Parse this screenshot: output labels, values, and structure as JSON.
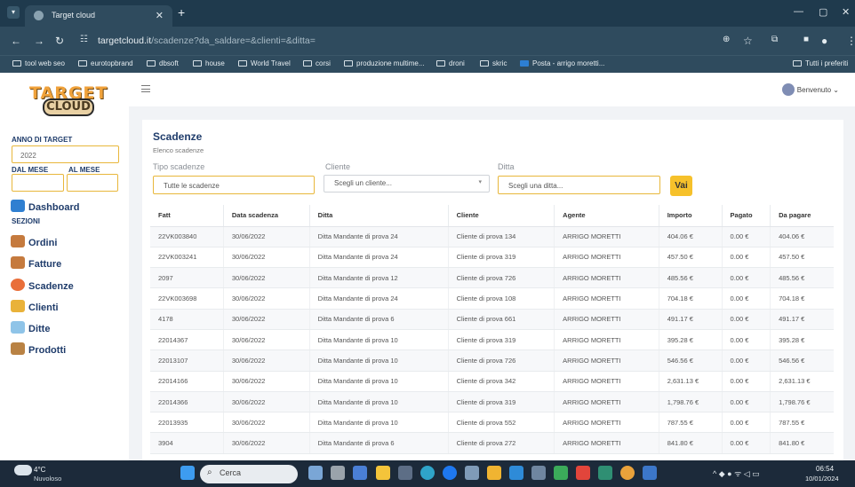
{
  "browser": {
    "tab_title": "Target cloud",
    "url_host": "targetcloud.it",
    "url_path": "/scadenze?da_saldare=&clienti=&ditta="
  },
  "bookmarks": [
    "tool web seo",
    "eurotopbrand",
    "dbsoft",
    "house",
    "World Travel",
    "corsi",
    "produzione multime...",
    "droni",
    "skric",
    "Posta - arrigo moretti...",
    "Tutti i preferiti"
  ],
  "sidebar": {
    "logo_top": "TARGET",
    "logo_bottom": "CLOUD",
    "year_label": "ANNO DI TARGET",
    "year_value": "2022",
    "from_label": "DAL MESE",
    "to_label": "AL MESE",
    "dashboard": "Dashboard",
    "section": "SEZIONI",
    "items": [
      "Ordini",
      "Fatture",
      "Scadenze",
      "Clienti",
      "Ditte",
      "Prodotti"
    ]
  },
  "header": {
    "user": "Benvenuto"
  },
  "main": {
    "title": "Scadenze",
    "subtitle": "Elenco scadenze",
    "filters": {
      "tipo_label": "Tipo scadenze",
      "tipo_value": "Tutte le scadenze",
      "cliente_label": "Cliente",
      "cliente_placeholder": "Scegli un cliente...",
      "ditta_label": "Ditta",
      "ditta_placeholder": "Scegli una ditta...",
      "go": "Vai"
    },
    "columns": [
      "Fatt",
      "Data scadenza",
      "Ditta",
      "Cliente",
      "Agente",
      "Importo",
      "Pagato",
      "Da pagare"
    ],
    "rows": [
      [
        "22VK003840",
        "30/06/2022",
        "Ditta Mandante di prova 24",
        "Cliente di prova 134",
        "ARRIGO MORETTI",
        "404.06 €",
        "0.00 €",
        "404.06 €"
      ],
      [
        "22VK003241",
        "30/06/2022",
        "Ditta Mandante di prova 24",
        "Cliente di prova 319",
        "ARRIGO MORETTI",
        "457.50 €",
        "0.00 €",
        "457.50 €"
      ],
      [
        "2097",
        "30/06/2022",
        "Ditta Mandante di prova 12",
        "Cliente di prova 726",
        "ARRIGO MORETTI",
        "485.56 €",
        "0.00 €",
        "485.56 €"
      ],
      [
        "22VK003698",
        "30/06/2022",
        "Ditta Mandante di prova 24",
        "Cliente di prova 108",
        "ARRIGO MORETTI",
        "704.18 €",
        "0.00 €",
        "704.18 €"
      ],
      [
        "4178",
        "30/06/2022",
        "Ditta Mandante di prova 6",
        "Cliente di prova 661",
        "ARRIGO MORETTI",
        "491.17 €",
        "0.00 €",
        "491.17 €"
      ],
      [
        "22014367",
        "30/06/2022",
        "Ditta Mandante di prova 10",
        "Cliente di prova 319",
        "ARRIGO MORETTI",
        "395.28 €",
        "0.00 €",
        "395.28 €"
      ],
      [
        "22013107",
        "30/06/2022",
        "Ditta Mandante di prova 10",
        "Cliente di prova 726",
        "ARRIGO MORETTI",
        "546.56 €",
        "0.00 €",
        "546.56 €"
      ],
      [
        "22014166",
        "30/06/2022",
        "Ditta Mandante di prova 10",
        "Cliente di prova 342",
        "ARRIGO MORETTI",
        "2,631.13 €",
        "0.00 €",
        "2,631.13 €"
      ],
      [
        "22014366",
        "30/06/2022",
        "Ditta Mandante di prova 10",
        "Cliente di prova 319",
        "ARRIGO MORETTI",
        "1,798.76 €",
        "0.00 €",
        "1,798.76 €"
      ],
      [
        "22013935",
        "30/06/2022",
        "Ditta Mandante di prova 10",
        "Cliente di prova 552",
        "ARRIGO MORETTI",
        "787.55 €",
        "0.00 €",
        "787.55 €"
      ],
      [
        "3904",
        "30/06/2022",
        "Ditta Mandante di prova 6",
        "Cliente di prova 272",
        "ARRIGO MORETTI",
        "841.80 €",
        "0.00 €",
        "841.80 €"
      ]
    ]
  },
  "taskbar": {
    "weather_temp": "4°C",
    "weather_desc": "Nuvoloso",
    "search": "Cerca",
    "time": "06:54",
    "date": "10/01/2024"
  },
  "colors": {
    "accent": "#f6c12b",
    "nav_text": "#1f3c6b",
    "browser_bg": "#2f4b5e"
  }
}
